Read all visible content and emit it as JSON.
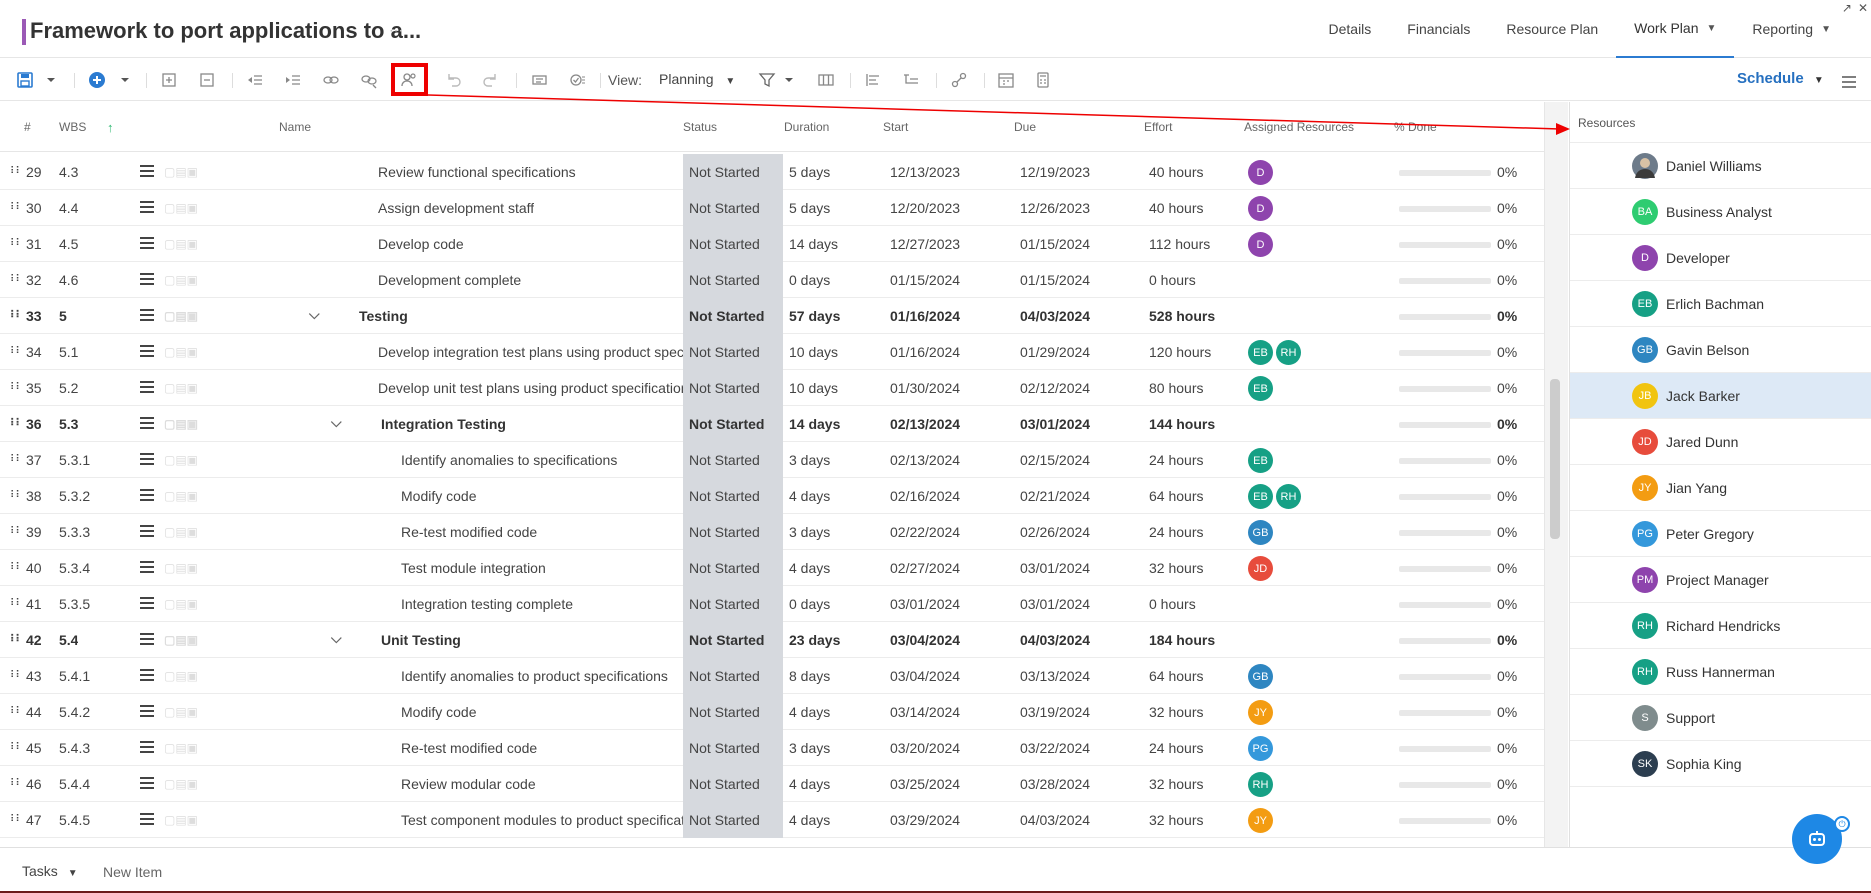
{
  "header": {
    "title": "Framework to port applications to a...",
    "title_more": "⋯",
    "nav": [
      {
        "label": "Details",
        "caret": ""
      },
      {
        "label": "Financials",
        "caret": ""
      },
      {
        "label": "Resource Plan",
        "caret": ""
      },
      {
        "label": "Work Plan",
        "caret": "▼"
      },
      {
        "label": "Reporting",
        "caret": "▼"
      }
    ]
  },
  "toolbar": {
    "view_label": "View:",
    "view_value": "Planning",
    "schedule_label": "Schedule"
  },
  "columns": {
    "num": "#",
    "wbs": "WBS",
    "name": "Name",
    "status": "Status",
    "duration": "Duration",
    "start": "Start",
    "due": "Due",
    "effort": "Effort",
    "assigned": "Assigned Resources",
    "done": "% Done"
  },
  "rows": [
    {
      "num": "29",
      "wbs": "4.3",
      "name": "Review functional specifications",
      "status": "Not Started",
      "duration": "5 days",
      "start": "12/13/2023",
      "due": "12/19/2023",
      "effort": "40 hours",
      "avatars": [
        {
          "initials": "D",
          "color": "#8e44ad"
        }
      ],
      "done": "0%"
    },
    {
      "num": "30",
      "wbs": "4.4",
      "name": "Assign development staff",
      "status": "Not Started",
      "duration": "5 days",
      "start": "12/20/2023",
      "due": "12/26/2023",
      "effort": "40 hours",
      "avatars": [
        {
          "initials": "D",
          "color": "#8e44ad"
        }
      ],
      "done": "0%"
    },
    {
      "num": "31",
      "wbs": "4.5",
      "name": "Develop code",
      "status": "Not Started",
      "duration": "14 days",
      "start": "12/27/2023",
      "due": "01/15/2024",
      "effort": "112 hours",
      "avatars": [
        {
          "initials": "D",
          "color": "#8e44ad"
        }
      ],
      "done": "0%"
    },
    {
      "num": "32",
      "wbs": "4.6",
      "name": "Development complete",
      "status": "Not Started",
      "duration": "0 days",
      "start": "01/15/2024",
      "due": "01/15/2024",
      "effort": "0 hours",
      "avatars": [],
      "done": "0%"
    },
    {
      "num": "33",
      "wbs": "5",
      "name": "Testing",
      "status": "Not Started",
      "duration": "57 days",
      "start": "01/16/2024",
      "due": "04/03/2024",
      "effort": "528 hours",
      "avatars": [],
      "done": "0%",
      "summary": true,
      "level": 0
    },
    {
      "num": "34",
      "wbs": "5.1",
      "name": "Develop integration test plans using product specifica",
      "status": "Not Started",
      "duration": "10 days",
      "start": "01/16/2024",
      "due": "01/29/2024",
      "effort": "120 hours",
      "avatars": [
        {
          "initials": "EB",
          "color": "#16a085"
        },
        {
          "initials": "RH",
          "color": "#16a085"
        }
      ],
      "done": "0%"
    },
    {
      "num": "35",
      "wbs": "5.2",
      "name": "Develop unit test plans using product specifications",
      "status": "Not Started",
      "duration": "10 days",
      "start": "01/30/2024",
      "due": "02/12/2024",
      "effort": "80 hours",
      "avatars": [
        {
          "initials": "EB",
          "color": "#16a085"
        }
      ],
      "done": "0%"
    },
    {
      "num": "36",
      "wbs": "5.3",
      "name": "Integration Testing",
      "status": "Not Started",
      "duration": "14 days",
      "start": "02/13/2024",
      "due": "03/01/2024",
      "effort": "144 hours",
      "avatars": [],
      "done": "0%",
      "summary": true,
      "level": 1
    },
    {
      "num": "37",
      "wbs": "5.3.1",
      "name": "Identify anomalies to specifications",
      "status": "Not Started",
      "duration": "3 days",
      "start": "02/13/2024",
      "due": "02/15/2024",
      "effort": "24 hours",
      "avatars": [
        {
          "initials": "EB",
          "color": "#16a085"
        }
      ],
      "done": "0%",
      "level": 2
    },
    {
      "num": "38",
      "wbs": "5.3.2",
      "name": "Modify code",
      "status": "Not Started",
      "duration": "4 days",
      "start": "02/16/2024",
      "due": "02/21/2024",
      "effort": "64 hours",
      "avatars": [
        {
          "initials": "EB",
          "color": "#16a085"
        },
        {
          "initials": "RH",
          "color": "#16a085"
        }
      ],
      "done": "0%",
      "level": 2
    },
    {
      "num": "39",
      "wbs": "5.3.3",
      "name": "Re-test modified code",
      "status": "Not Started",
      "duration": "3 days",
      "start": "02/22/2024",
      "due": "02/26/2024",
      "effort": "24 hours",
      "avatars": [
        {
          "initials": "GB",
          "color": "#2e86c1"
        }
      ],
      "done": "0%",
      "level": 2
    },
    {
      "num": "40",
      "wbs": "5.3.4",
      "name": "Test module integration",
      "status": "Not Started",
      "duration": "4 days",
      "start": "02/27/2024",
      "due": "03/01/2024",
      "effort": "32 hours",
      "avatars": [
        {
          "initials": "JD",
          "color": "#e74c3c"
        }
      ],
      "done": "0%",
      "level": 2
    },
    {
      "num": "41",
      "wbs": "5.3.5",
      "name": "Integration testing complete",
      "status": "Not Started",
      "duration": "0 days",
      "start": "03/01/2024",
      "due": "03/01/2024",
      "effort": "0 hours",
      "avatars": [],
      "done": "0%",
      "level": 2
    },
    {
      "num": "42",
      "wbs": "5.4",
      "name": "Unit Testing",
      "status": "Not Started",
      "duration": "23 days",
      "start": "03/04/2024",
      "due": "04/03/2024",
      "effort": "184 hours",
      "avatars": [],
      "done": "0%",
      "summary": true,
      "level": 1
    },
    {
      "num": "43",
      "wbs": "5.4.1",
      "name": "Identify anomalies to product specifications",
      "status": "Not Started",
      "duration": "8 days",
      "start": "03/04/2024",
      "due": "03/13/2024",
      "effort": "64 hours",
      "avatars": [
        {
          "initials": "GB",
          "color": "#2e86c1"
        }
      ],
      "done": "0%",
      "level": 2
    },
    {
      "num": "44",
      "wbs": "5.4.2",
      "name": "Modify code",
      "status": "Not Started",
      "duration": "4 days",
      "start": "03/14/2024",
      "due": "03/19/2024",
      "effort": "32 hours",
      "avatars": [
        {
          "initials": "JY",
          "color": "#f39c12"
        }
      ],
      "done": "0%",
      "level": 2
    },
    {
      "num": "45",
      "wbs": "5.4.3",
      "name": "Re-test modified code",
      "status": "Not Started",
      "duration": "3 days",
      "start": "03/20/2024",
      "due": "03/22/2024",
      "effort": "24 hours",
      "avatars": [
        {
          "initials": "PG",
          "color": "#3498db"
        }
      ],
      "done": "0%",
      "level": 2
    },
    {
      "num": "46",
      "wbs": "5.4.4",
      "name": "Review modular code",
      "status": "Not Started",
      "duration": "4 days",
      "start": "03/25/2024",
      "due": "03/28/2024",
      "effort": "32 hours",
      "avatars": [
        {
          "initials": "RH",
          "color": "#16a085"
        }
      ],
      "done": "0%",
      "level": 2
    },
    {
      "num": "47",
      "wbs": "5.4.5",
      "name": "Test component modules to product specification",
      "status": "Not Started",
      "duration": "4 days",
      "start": "03/29/2024",
      "due": "04/03/2024",
      "effort": "32 hours",
      "avatars": [
        {
          "initials": "JY",
          "color": "#f39c12"
        }
      ],
      "done": "0%",
      "level": 2
    }
  ],
  "resources": {
    "title": "Resources",
    "items": [
      {
        "name": "Daniel Williams",
        "initials": "DW",
        "color": "#6d7b8a",
        "photo": true
      },
      {
        "name": "Business Analyst",
        "initials": "BA",
        "color": "#2ecc71"
      },
      {
        "name": "Developer",
        "initials": "D",
        "color": "#8e44ad"
      },
      {
        "name": "Erlich Bachman",
        "initials": "EB",
        "color": "#16a085"
      },
      {
        "name": "Gavin Belson",
        "initials": "GB",
        "color": "#2e86c1"
      },
      {
        "name": "Jack Barker",
        "initials": "JB",
        "color": "#f1c40f",
        "selected": true
      },
      {
        "name": "Jared Dunn",
        "initials": "JD",
        "color": "#e74c3c"
      },
      {
        "name": "Jian Yang",
        "initials": "JY",
        "color": "#f39c12"
      },
      {
        "name": "Peter Gregory",
        "initials": "PG",
        "color": "#3498db"
      },
      {
        "name": "Project Manager",
        "initials": "PM",
        "color": "#8e44ad"
      },
      {
        "name": "Richard Hendricks",
        "initials": "RH",
        "color": "#16a085"
      },
      {
        "name": "Russ Hannerman",
        "initials": "RH",
        "color": "#16a085"
      },
      {
        "name": "Support",
        "initials": "S",
        "color": "#7f8c8d"
      },
      {
        "name": "Sophia King",
        "initials": "SK",
        "color": "#2c3e50"
      }
    ]
  },
  "footer": {
    "tasks_label": "Tasks",
    "new_item_label": "New Item"
  },
  "colors": {
    "accent": "#2b7bd1",
    "title_bar": "#9b59b6",
    "status_bg": "#d6d9de",
    "annotation": "#e00000"
  }
}
